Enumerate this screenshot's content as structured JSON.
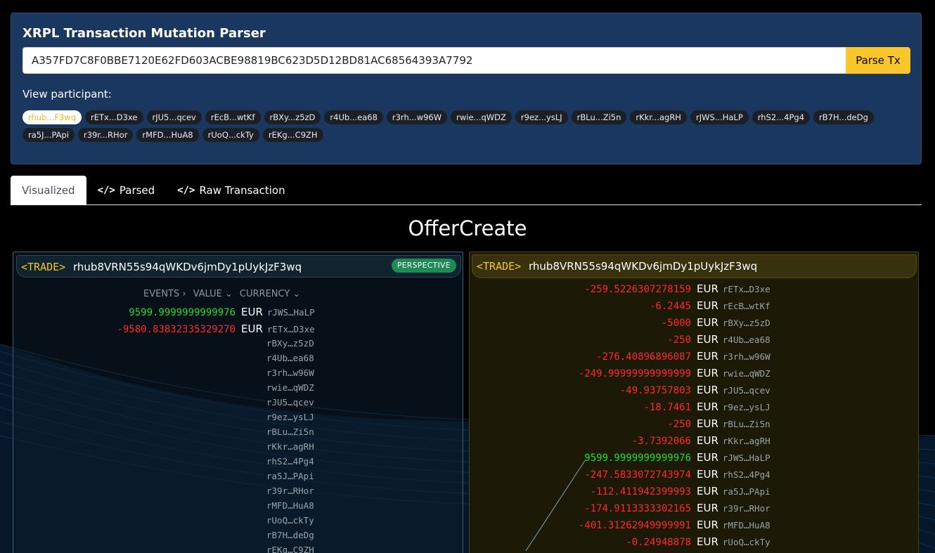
{
  "header": {
    "title": "XRPL Transaction Mutation Parser",
    "tx_hash_value": "A357FD7C8F0BBE7120E62FD603ACBE98819BC623D5D12BD81AC68564393A7792",
    "parse_button": "Parse Tx",
    "participant_label": "View participant:",
    "participants": [
      "rhub...F3wq",
      "rETx...D3xe",
      "rJU5...qcev",
      "rEcB...wtKf",
      "rBXy...z5zD",
      "r4Ub...ea68",
      "r3rh...w96W",
      "rwie...qWDZ",
      "r9ez...ysLJ",
      "rBLu...Zi5n",
      "rKkr...agRH",
      "rJWS...HaLP",
      "rhS2...4Pg4",
      "rB7H...deDg",
      "ra5J...PApi",
      "r39r...RHor",
      "rMFD...HuA8",
      "rUoQ...ckTy",
      "rEKg...C9ZH"
    ]
  },
  "tabs": {
    "visualized": "Visualized",
    "parsed": "Parsed",
    "raw": "Raw Transaction"
  },
  "tx_type": "OfferCreate",
  "left_panel": {
    "trade_tag": "<TRADE>",
    "account": "rhub8VRN55s94qWKDv6jmDy1pUykJzF3wq",
    "badge": "PERSPECTIVE",
    "columns": {
      "events": "EVENTS",
      "value": "VALUE",
      "currency": "CURRENCY"
    },
    "rows": [
      {
        "value": "9599.9999999999976",
        "currency": "EUR",
        "account": "rJWS…HaLP",
        "sign": "pos"
      },
      {
        "value": "-9580.83832335329270",
        "currency": "EUR",
        "account": "rETx…D3xe",
        "sign": "neg"
      }
    ],
    "accounts": [
      "rBXy…z5zD",
      "r4Ub…ea68",
      "r3rh…w96W",
      "rwie…qWDZ",
      "rJU5…qcev",
      "r9ez…ysLJ",
      "rBLu…Zi5n",
      "rKkr…agRH",
      "rhS2…4Pg4",
      "ra5J…PApi",
      "r39r…RHor",
      "rMFD…HuA8",
      "rUoQ…ckTy",
      "rB7H…deDg",
      "rEKg…C9ZH"
    ]
  },
  "right_panel": {
    "trade_tag": "<TRADE>",
    "account": "rhub8VRN55s94qWKDv6jmDy1pUykJzF3wq",
    "rows": [
      {
        "value": "-259.5226307278159",
        "currency": "EUR",
        "account": "rETx…D3xe",
        "sign": "neg"
      },
      {
        "value": "-6.2445",
        "currency": "EUR",
        "account": "rEcB…wtKf",
        "sign": "neg"
      },
      {
        "value": "-5000",
        "currency": "EUR",
        "account": "rBXy…z5zD",
        "sign": "neg"
      },
      {
        "value": "-250",
        "currency": "EUR",
        "account": "r4Ub…ea68",
        "sign": "neg"
      },
      {
        "value": "-276.40896896087",
        "currency": "EUR",
        "account": "r3rh…w96W",
        "sign": "neg"
      },
      {
        "value": "-249.99999999999999",
        "currency": "EUR",
        "account": "rwie…qWDZ",
        "sign": "neg"
      },
      {
        "value": "-49.93757803",
        "currency": "EUR",
        "account": "rJU5…qcev",
        "sign": "neg"
      },
      {
        "value": "-18.7461",
        "currency": "EUR",
        "account": "r9ez…ysLJ",
        "sign": "neg"
      },
      {
        "value": "-250",
        "currency": "EUR",
        "account": "rBLu…Zi5n",
        "sign": "neg"
      },
      {
        "value": "-3.7392066",
        "currency": "EUR",
        "account": "rKkr…agRH",
        "sign": "neg"
      },
      {
        "value": "9599.9999999999976",
        "currency": "EUR",
        "account": "rJWS…HaLP",
        "sign": "pos"
      },
      {
        "value": "-247.5833072743974",
        "currency": "EUR",
        "account": "rhS2…4Pg4",
        "sign": "neg"
      },
      {
        "value": "-112.411942399993",
        "currency": "EUR",
        "account": "ra5J…PApi",
        "sign": "neg"
      },
      {
        "value": "-174.9113333302165",
        "currency": "EUR",
        "account": "r39r…RHor",
        "sign": "neg"
      },
      {
        "value": "-401.31262949999991",
        "currency": "EUR",
        "account": "rMFD…HuA8",
        "sign": "neg"
      },
      {
        "value": "-0.24948878",
        "currency": "EUR",
        "account": "rUoQ…ckTy",
        "sign": "neg"
      }
    ]
  },
  "colors": {
    "accent": "#f9c62b",
    "positive": "#28dc2c",
    "negative": "#ff2a2a",
    "header_bg": "#19375f",
    "badge": "#1f8a55"
  }
}
